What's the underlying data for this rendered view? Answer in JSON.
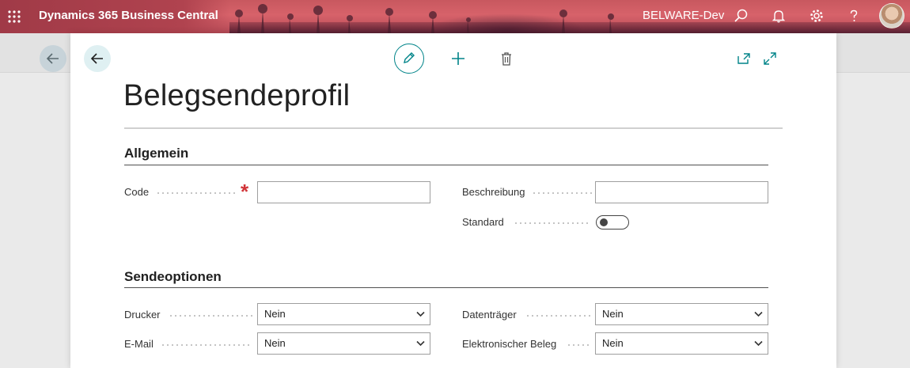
{
  "appbar": {
    "title": "Dynamics 365 Business Central",
    "environment": "BELWARE-Dev",
    "icons": [
      "app-launcher-icon",
      "search-icon",
      "bell-icon",
      "gear-icon",
      "help-icon",
      "avatar"
    ]
  },
  "toolbar": {
    "icons": [
      "back-arrow-icon",
      "edit-pencil-icon",
      "add-plus-icon",
      "delete-trash-icon",
      "open-new-window-icon",
      "expand-icon"
    ]
  },
  "page": {
    "title": "Belegsendeprofil"
  },
  "sections": {
    "general": {
      "heading": "Allgemein",
      "code_label": "Code",
      "code_value": "",
      "code_required": true,
      "description_label": "Beschreibung",
      "description_value": "",
      "default_label": "Standard",
      "default_on": false
    },
    "send_options": {
      "heading": "Sendeoptionen",
      "printer_label": "Drucker",
      "printer_value": "Nein",
      "email_label": "E-Mail",
      "email_value": "Nein",
      "disk_label": "Datenträger",
      "disk_value": "Nein",
      "edoc_label": "Elektronischer Beleg",
      "edoc_value": "Nein"
    }
  },
  "colors": {
    "accent": "#008489",
    "required": "#d13438",
    "appbar": "#c8585f"
  }
}
